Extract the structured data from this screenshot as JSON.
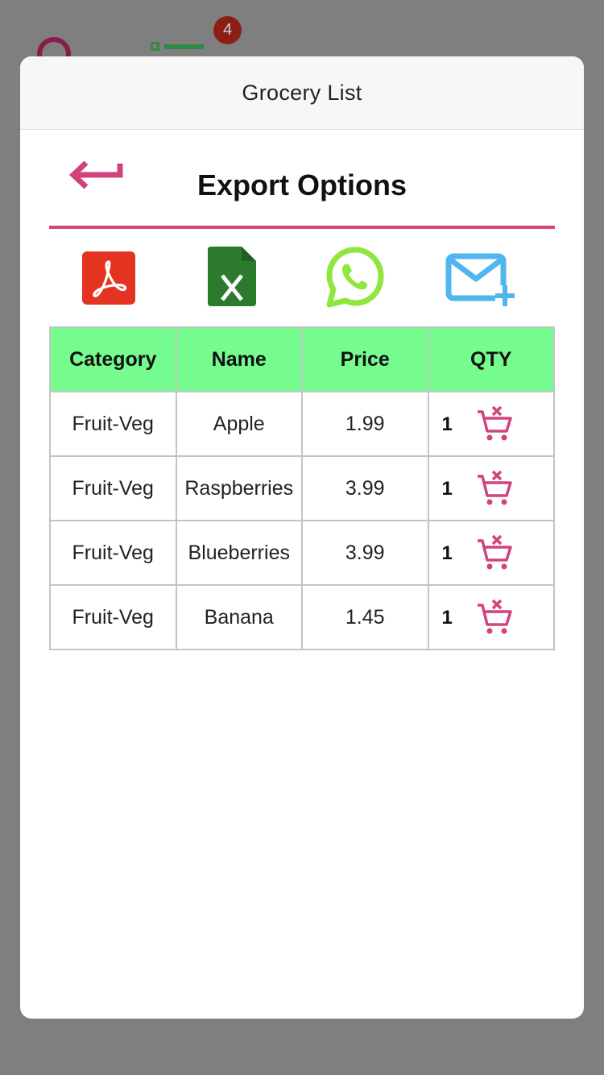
{
  "background": {
    "badge_count": "4"
  },
  "modal": {
    "title": "Grocery List"
  },
  "export": {
    "title": "Export Options",
    "options": [
      "pdf-icon",
      "excel-icon",
      "whatsapp-icon",
      "email-add-icon"
    ],
    "accent": "#d1437d"
  },
  "table": {
    "headers": {
      "category": "Category",
      "name": "Name",
      "price": "Price",
      "qty": "QTY"
    },
    "header_bg": "#76fb8f",
    "rows": [
      {
        "category": "Fruit-Veg",
        "name": "Apple",
        "price": "1.99",
        "qty": "1"
      },
      {
        "category": "Fruit-Veg",
        "name": "Raspberries",
        "price": "3.99",
        "qty": "1"
      },
      {
        "category": "Fruit-Veg",
        "name": "Blueberries",
        "price": "3.99",
        "qty": "1"
      },
      {
        "category": "Fruit-Veg",
        "name": "Banana",
        "price": "1.45",
        "qty": "1"
      }
    ]
  }
}
